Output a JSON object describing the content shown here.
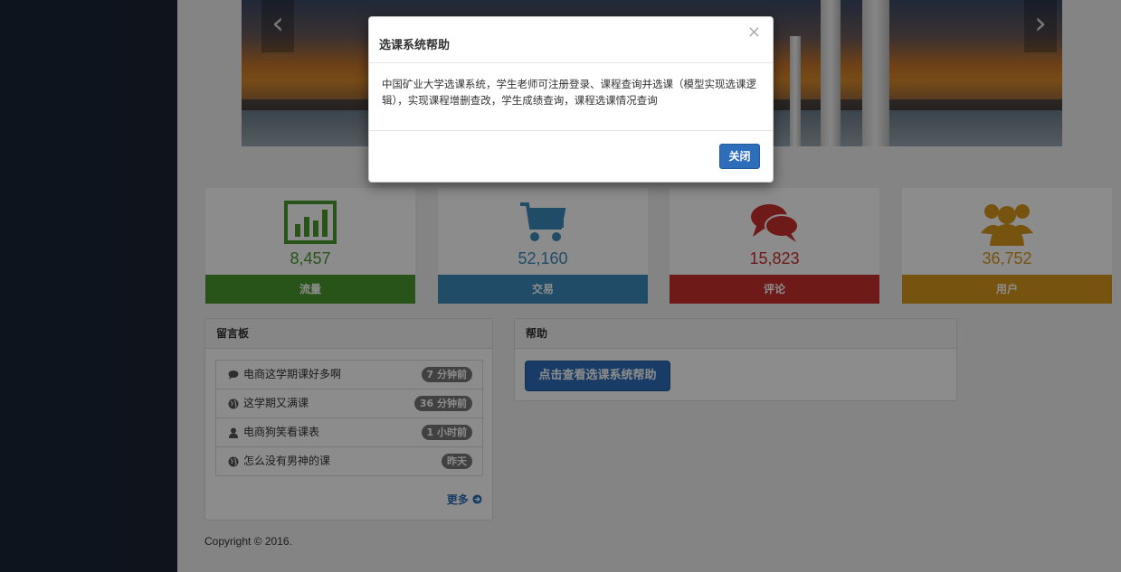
{
  "stats": [
    {
      "value": "8,457",
      "label": "流量",
      "color": "#4a9a2f",
      "icon": "bar-chart-icon"
    },
    {
      "value": "52,160",
      "label": "交易",
      "color": "#3b8bbd",
      "icon": "shopping-cart-icon"
    },
    {
      "value": "15,823",
      "label": "评论",
      "color": "#c9302c",
      "icon": "comments-icon"
    },
    {
      "value": "36,752",
      "label": "用户",
      "color": "#d9981e",
      "icon": "users-icon"
    }
  ],
  "message_board": {
    "title": "留言板",
    "items": [
      {
        "text": "电商这学期课好多啊",
        "time": "7 分钟前",
        "icon": "comment-icon"
      },
      {
        "text": "这学期又满课",
        "time": "36 分钟前",
        "icon": "globe-icon"
      },
      {
        "text": "电商狗笑看课表",
        "time": "1 小时前",
        "icon": "user-icon"
      },
      {
        "text": "怎么没有男神的课",
        "time": "昨天",
        "icon": "globe-icon"
      }
    ],
    "more_label": "更多"
  },
  "help_panel": {
    "title": "帮助",
    "button_label": "点击查看选课系统帮助"
  },
  "footer": {
    "copyright": "Copyright © 2016."
  },
  "modal": {
    "title": "选课系统帮助",
    "body": "中国矿业大学选课系统，学生老师可注册登录、课程查询并选课（模型实现选课逻辑），实现课程增删查改，学生成绩查询，课程选课情况查询",
    "close_button_label": "关闭",
    "close_symbol": "×"
  },
  "carousel": {
    "prev_symbol": "‹",
    "next_symbol": "›"
  }
}
